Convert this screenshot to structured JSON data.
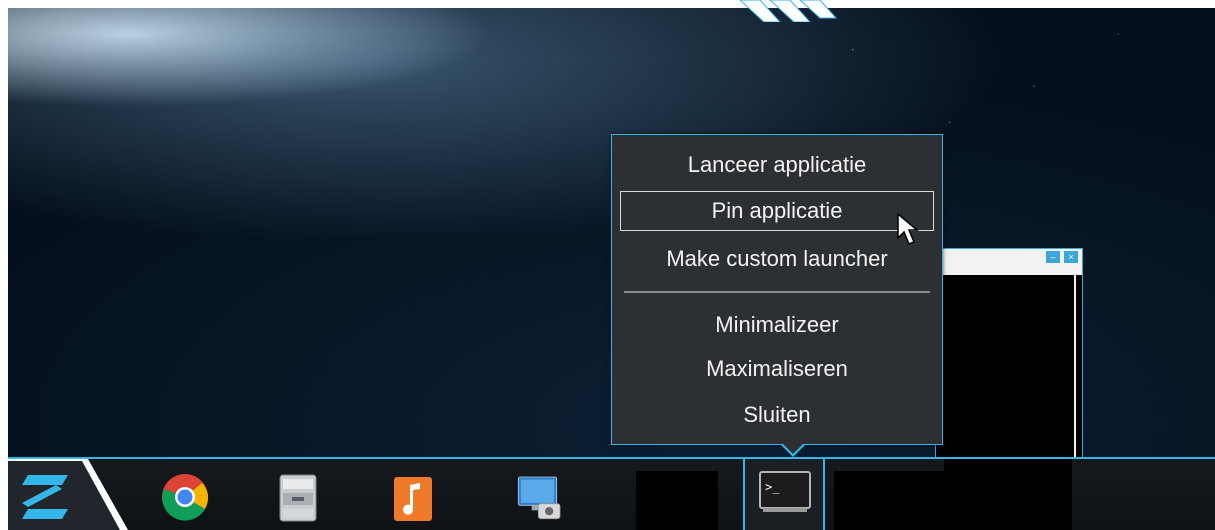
{
  "context_menu": {
    "items": [
      {
        "label": "Lanceer applicatie"
      },
      {
        "label": "Pin applicatie"
      },
      {
        "label": "Make custom launcher"
      },
      {
        "label": "Minimalizeer"
      },
      {
        "label": "Maximaliseren"
      },
      {
        "label": "Sluiten"
      }
    ],
    "hover_index": 1
  },
  "taskbar": {
    "apps": [
      {
        "icon": "chrome-icon"
      },
      {
        "icon": "file-manager-icon"
      },
      {
        "icon": "music-player-icon"
      },
      {
        "icon": "display-settings-icon"
      },
      {
        "icon": "app-icon"
      },
      {
        "icon": "terminal-icon"
      }
    ]
  },
  "terminal": {
    "prompt": ">_"
  },
  "colors": {
    "accent": "#35b6e8",
    "menu_bg": "#2c2f33",
    "taskbar_bg": "#12161a"
  }
}
